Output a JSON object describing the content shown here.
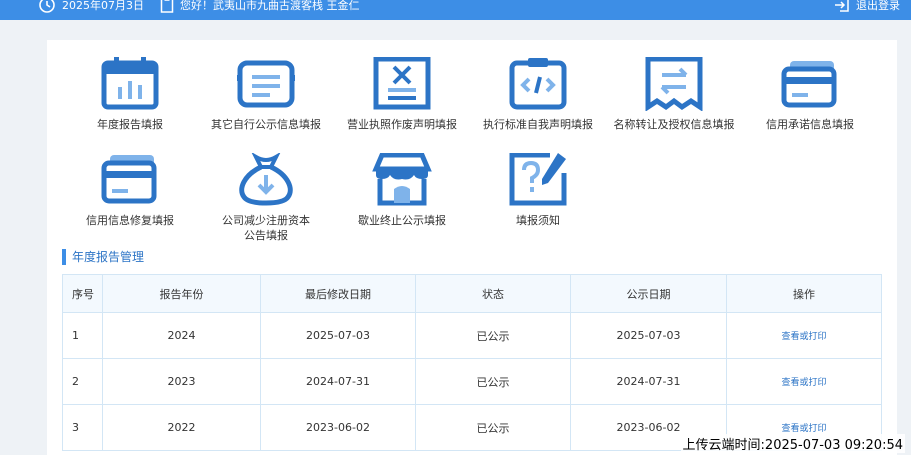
{
  "header": {
    "date": "2025年07月3日",
    "greeting": "您好！武夷山市九曲古渡客栈 王金仁",
    "logout": "退出登录"
  },
  "functions": [
    {
      "label": "年度报告填报",
      "icon": "calendar-icon"
    },
    {
      "label": "其它自行公示信息填报",
      "icon": "document-list-icon"
    },
    {
      "label": "营业执照作废声明填报",
      "icon": "void-document-icon"
    },
    {
      "label": "执行标准自我声明填报",
      "icon": "code-clipboard-icon"
    },
    {
      "label": "名称转让及授权信息填报",
      "icon": "transfer-icon"
    },
    {
      "label": "信用承诺信息填报",
      "icon": "credit-card-icon"
    },
    {
      "label": "信用信息修复填报",
      "icon": "credit-repair-icon"
    },
    {
      "label_lines": [
        "公司减少注册资本",
        "公告填报"
      ],
      "icon": "money-bag-icon"
    },
    {
      "label": "歇业终止公示填报",
      "icon": "store-icon"
    },
    {
      "label": "填报须知",
      "icon": "notice-edit-icon"
    }
  ],
  "section": {
    "title": "年度报告管理"
  },
  "table": {
    "headers": [
      "序号",
      "报告年份",
      "最后修改日期",
      "状态",
      "公示日期",
      "操作"
    ],
    "rows": [
      [
        "1",
        "2024",
        "2025-07-03",
        "已公示",
        "2025-07-03",
        "查看或打印"
      ],
      [
        "2",
        "2023",
        "2024-07-31",
        "已公示",
        "2024-07-31",
        "查看或打印"
      ],
      [
        "3",
        "2022",
        "2023-06-02",
        "已公示",
        "2023-06-02",
        "查看或打印"
      ]
    ]
  },
  "overlay": {
    "upload_time": "上传云端时间:2025-07-03 09:20:54"
  },
  "colors": {
    "accent": "#3d8ee6",
    "icon": "#2c74c6",
    "link": "#2c74c6"
  }
}
